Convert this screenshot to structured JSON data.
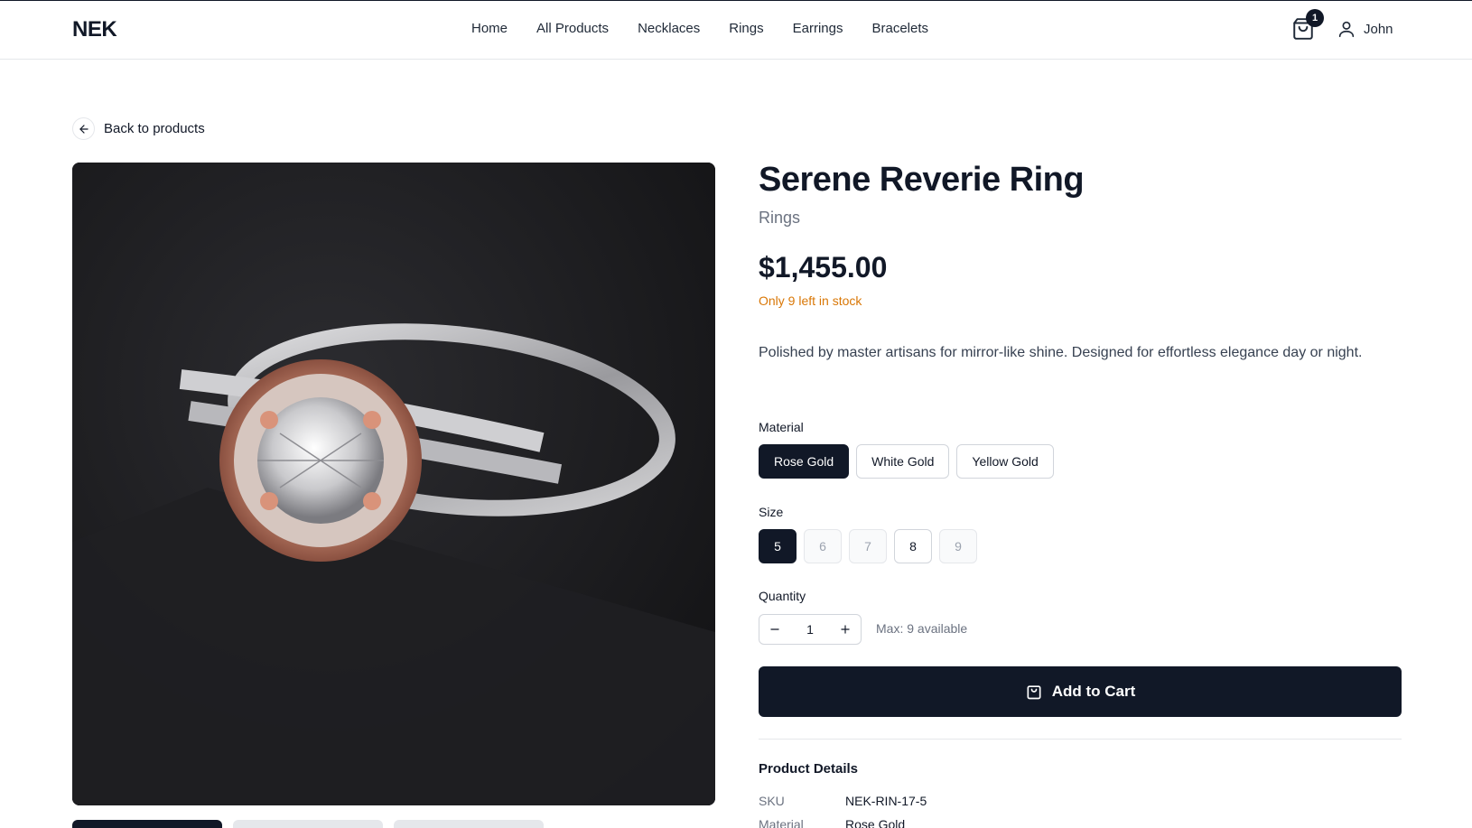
{
  "header": {
    "logo": "NEK",
    "nav": [
      "Home",
      "All Products",
      "Necklaces",
      "Rings",
      "Earrings",
      "Bracelets"
    ],
    "cart_count": "1",
    "user_name": "John"
  },
  "back_link": "Back to products",
  "product": {
    "title": "Serene Reverie Ring",
    "category": "Rings",
    "price": "$1,455.00",
    "stock": "Only 9 left in stock",
    "description": "Polished by master artisans for mirror-like shine. Designed for effortless elegance day or night.",
    "material_label": "Material",
    "materials": [
      "Rose Gold",
      "White Gold",
      "Yellow Gold"
    ],
    "size_label": "Size",
    "sizes": [
      "5",
      "6",
      "7",
      "8",
      "9"
    ],
    "quantity_label": "Quantity",
    "quantity": "1",
    "max_text": "Max: 9 available",
    "add_to_cart": "Add to Cart"
  },
  "details": {
    "title": "Product Details",
    "rows": [
      {
        "key": "SKU",
        "value": "NEK-RIN-17-5"
      },
      {
        "key": "Material",
        "value": "Rose Gold"
      }
    ]
  },
  "colors": {
    "primary": "#111827",
    "stock_warning": "#d97706",
    "muted": "#6b7280"
  }
}
